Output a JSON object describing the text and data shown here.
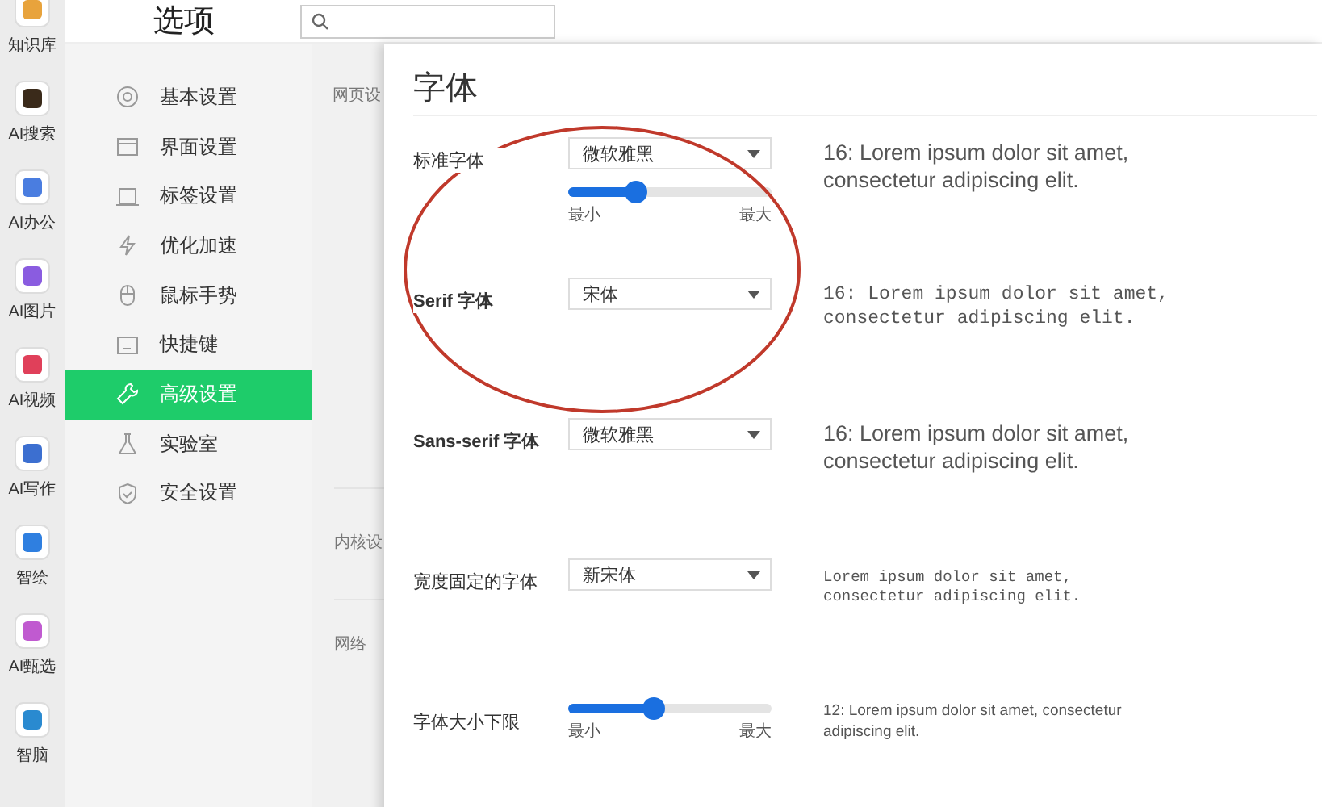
{
  "rail": [
    {
      "label": "知识库"
    },
    {
      "label": "AI搜索"
    },
    {
      "label": "AI办公"
    },
    {
      "label": "AI图片"
    },
    {
      "label": "AI视频"
    },
    {
      "label": "AI写作"
    },
    {
      "label": "智绘"
    },
    {
      "label": "AI甄选"
    },
    {
      "label": "智脑"
    }
  ],
  "window": {
    "title": "选项"
  },
  "sidebar": {
    "items": [
      {
        "label": "基本设置",
        "selected": false
      },
      {
        "label": "界面设置",
        "selected": false
      },
      {
        "label": "标签设置",
        "selected": false
      },
      {
        "label": "优化加速",
        "selected": false
      },
      {
        "label": "鼠标手势",
        "selected": false
      },
      {
        "label": "快捷键",
        "selected": false
      },
      {
        "label": "高级设置",
        "selected": true
      },
      {
        "label": "实验室",
        "selected": false
      },
      {
        "label": "安全设置",
        "selected": false
      }
    ]
  },
  "sections": [
    "网页设",
    "内核设",
    "网络"
  ],
  "panel": {
    "title": "字体",
    "annotation": {
      "kind": "ellipse"
    },
    "rows": [
      {
        "label": "标准字体",
        "bold": false,
        "select": "微软雅黑",
        "slider": {
          "level": 0.33,
          "min_label": "最小",
          "max_label": "最大"
        },
        "preview": "16: Lorem ipsum dolor sit amet,\nconsectetur adipiscing elit.",
        "kind": "sans"
      },
      {
        "label": "Serif 字体",
        "bold": true,
        "select": "宋体",
        "preview": "16: Lorem ipsum dolor sit amet,\nconsectetur adipiscing elit.",
        "kind": "serif"
      },
      {
        "label": "Sans-serif 字体",
        "bold": true,
        "select": "微软雅黑",
        "preview": "16: Lorem ipsum dolor sit amet,\nconsectetur adipiscing elit.",
        "kind": "sans"
      },
      {
        "label": "宽度固定的字体",
        "bold": false,
        "select": "新宋体",
        "preview": "Lorem ipsum dolor sit amet,\nconsectetur adipiscing elit.",
        "kind": "mono"
      },
      {
        "label": "字体大小下限",
        "bold": false,
        "slider": {
          "level": 0.42,
          "min_label": "最小",
          "max_label": "最大"
        },
        "preview": "12: Lorem ipsum dolor sit amet, consectetur\nadipiscing elit.",
        "kind": "small"
      }
    ]
  }
}
